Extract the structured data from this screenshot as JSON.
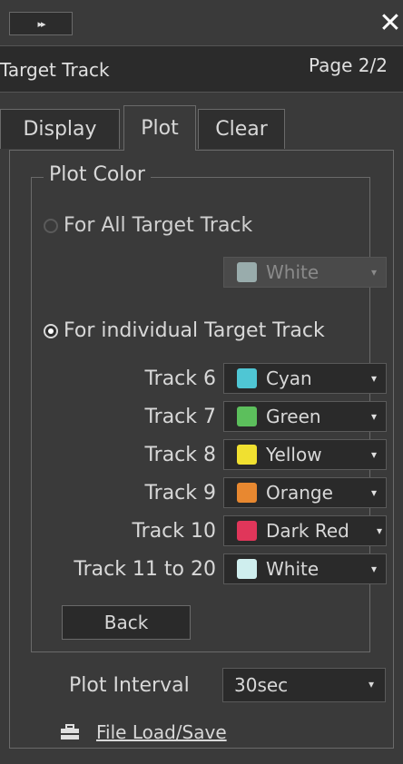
{
  "window": {
    "expand_glyph": "▸▸",
    "close_glyph": "✕",
    "title": "Target Track",
    "page": "Page 2/2"
  },
  "tabs": [
    {
      "label": "Display",
      "active": false
    },
    {
      "label": "Plot",
      "active": true
    },
    {
      "label": "Clear",
      "active": false
    }
  ],
  "plot_color": {
    "legend": "Plot Color",
    "all_option": {
      "label": "For All Target Track",
      "selected": false
    },
    "all_color": {
      "label": "White",
      "color": "#cfeeee",
      "enabled": false
    },
    "individual_option": {
      "label": "For individual Target Track",
      "selected": true
    },
    "tracks": [
      {
        "label": "Track 6",
        "color_name": "Cyan",
        "color": "#4fc6d4"
      },
      {
        "label": "Track 7",
        "color_name": "Green",
        "color": "#5cbf5c"
      },
      {
        "label": "Track 8",
        "color_name": "Yellow",
        "color": "#f0e030"
      },
      {
        "label": "Track 9",
        "color_name": "Orange",
        "color": "#e88830"
      },
      {
        "label": "Track 10",
        "color_name": "Dark Red",
        "color": "#e0365a"
      },
      {
        "label": "Track 11 to 20",
        "color_name": "White",
        "color": "#cfeeee"
      }
    ],
    "back_label": "Back"
  },
  "plot_interval": {
    "label": "Plot Interval",
    "value": "30sec"
  },
  "file": {
    "label": "File Load/Save",
    "icon": "toolbox-icon"
  },
  "icons": {
    "dropdown": "chevron-down-icon"
  }
}
